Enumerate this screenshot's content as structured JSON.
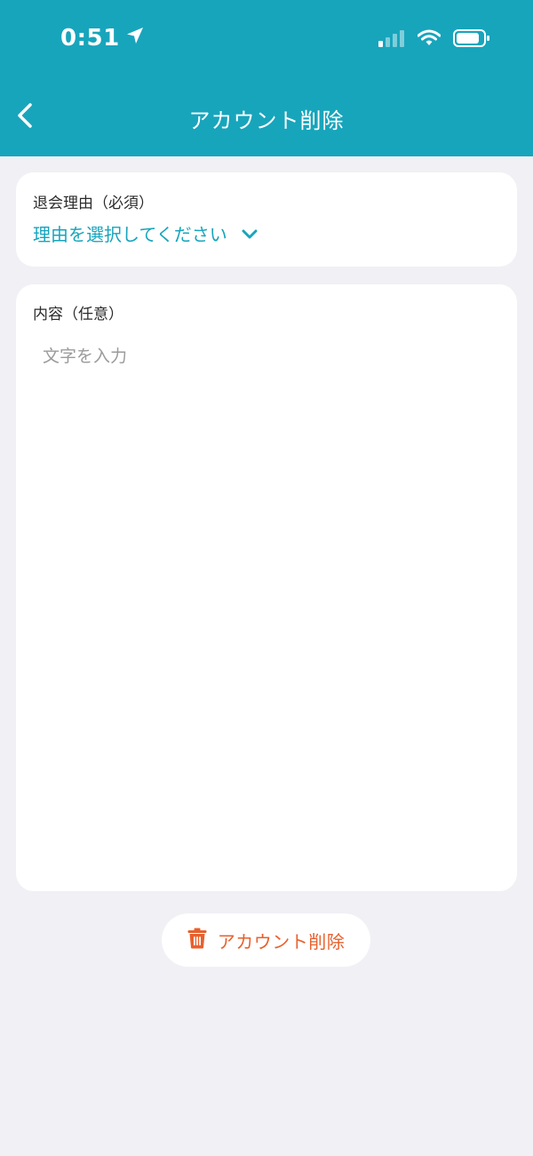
{
  "colors": {
    "header_bg": "#17A5BC",
    "accent": "#17A5BC",
    "danger": "#E8602C",
    "background": "#F0F0F5"
  },
  "status_bar": {
    "time": "0:51",
    "icons": [
      "location-arrow-icon",
      "cellular-signal-icon",
      "wifi-icon",
      "battery-icon"
    ]
  },
  "nav": {
    "title": "アカウント削除",
    "back_icon": "chevron-left-icon"
  },
  "reason": {
    "label": "退会理由（必須）",
    "select_placeholder": "理由を選択してください",
    "select_icon": "chevron-down-icon"
  },
  "content": {
    "label": "内容（任意）",
    "placeholder": "文字を入力",
    "value": ""
  },
  "delete_button": {
    "label": "アカウント削除",
    "icon": "trash-icon"
  }
}
